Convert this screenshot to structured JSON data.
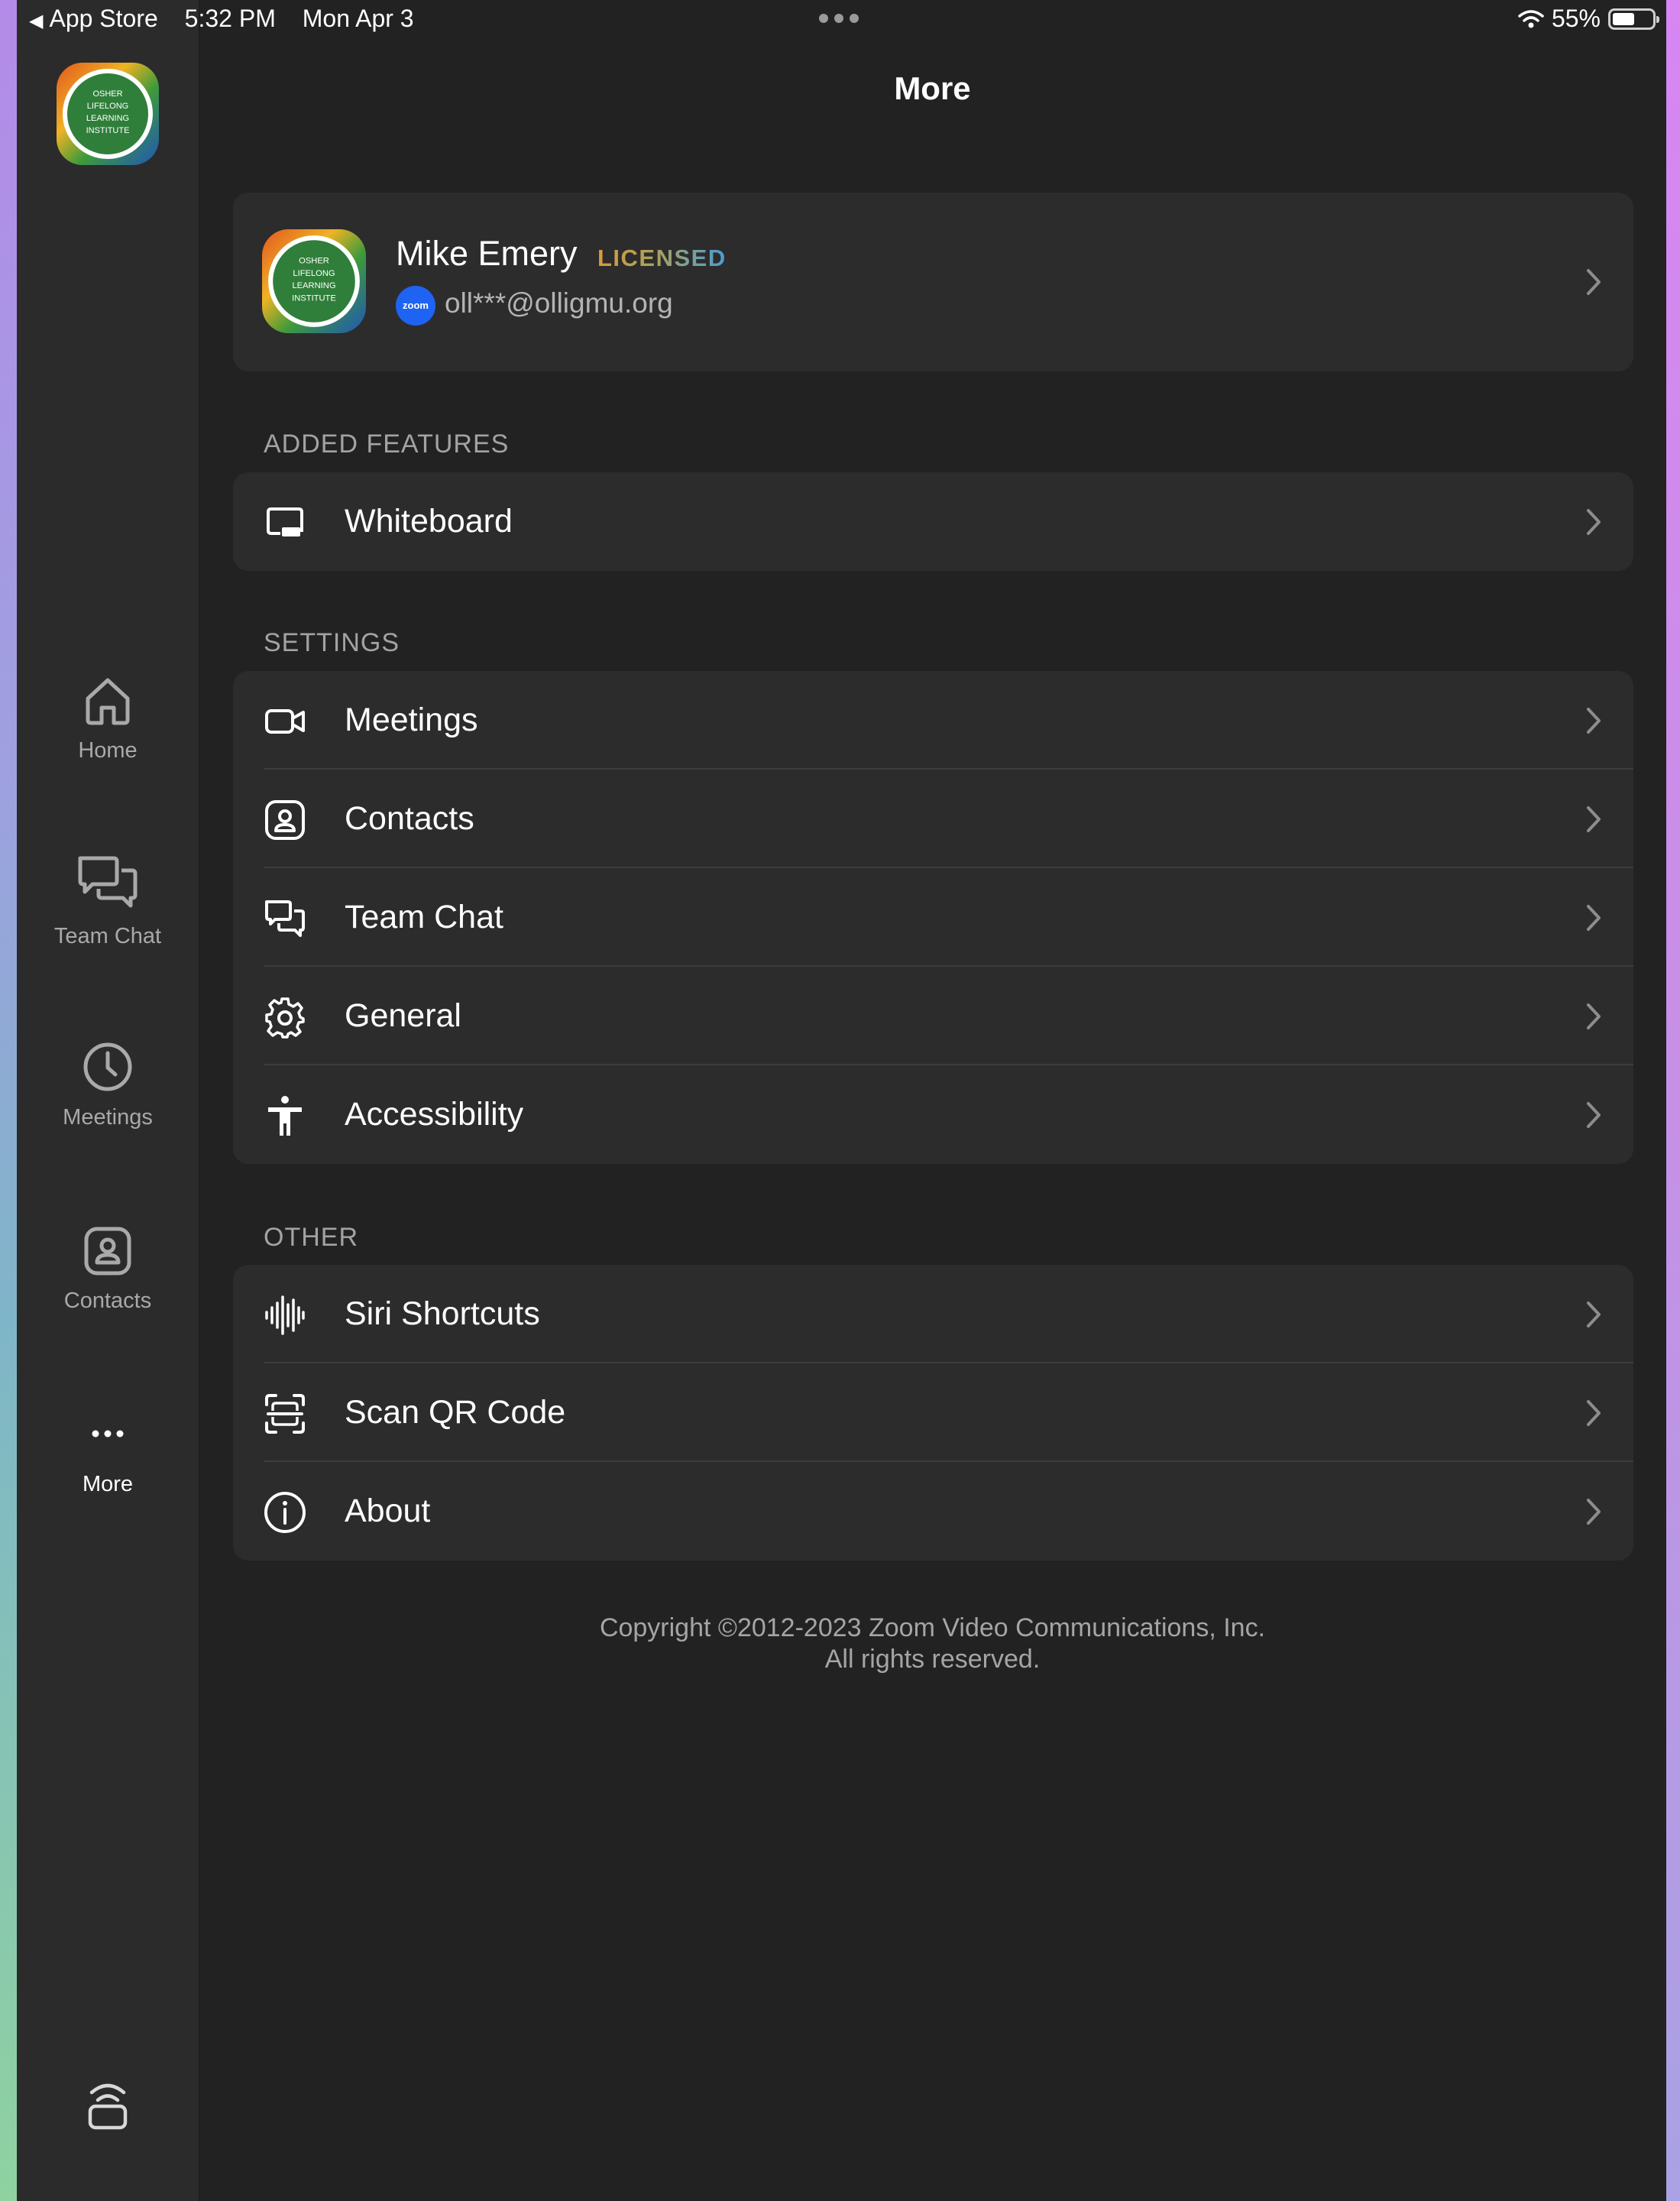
{
  "status_bar": {
    "back_label": "App Store",
    "time": "5:32 PM",
    "date": "Mon Apr 3",
    "battery": "55%",
    "battery_level": 0.55
  },
  "sidebar": {
    "logo_text": "OSHER LIFELONG LEARNING INSTITUTE",
    "items": [
      {
        "label": "Home",
        "icon": "home-icon",
        "active": false
      },
      {
        "label": "Team Chat",
        "icon": "chat-bubbles-icon",
        "active": false
      },
      {
        "label": "Meetings",
        "icon": "clock-icon",
        "active": false
      },
      {
        "label": "Contacts",
        "icon": "contact-card-icon",
        "active": false
      },
      {
        "label": "More",
        "icon": "more-dots-icon",
        "active": true
      }
    ],
    "bottom_icon": "ultrasonic-share-icon"
  },
  "page": {
    "title": "More"
  },
  "profile": {
    "name": "Mike Emery",
    "badge": "LICENSED",
    "email": "oll***@olligmu.org",
    "zoom_chip": "zoom"
  },
  "sections": {
    "added_features": {
      "header": "ADDED FEATURES",
      "items": [
        {
          "label": "Whiteboard",
          "icon": "whiteboard-icon"
        }
      ]
    },
    "settings": {
      "header": "SETTINGS",
      "items": [
        {
          "label": "Meetings",
          "icon": "video-camera-icon"
        },
        {
          "label": "Contacts",
          "icon": "contact-card-icon"
        },
        {
          "label": "Team Chat",
          "icon": "chat-bubbles-icon"
        },
        {
          "label": "General",
          "icon": "gear-icon"
        },
        {
          "label": "Accessibility",
          "icon": "accessibility-icon"
        }
      ]
    },
    "other": {
      "header": "OTHER",
      "items": [
        {
          "label": "Siri Shortcuts",
          "icon": "waveform-icon"
        },
        {
          "label": "Scan QR Code",
          "icon": "qr-scan-icon"
        },
        {
          "label": "About",
          "icon": "info-icon"
        }
      ]
    }
  },
  "footer": {
    "copyright_line1": "Copyright ©2012-2023 Zoom Video Communications, Inc.",
    "copyright_line2": "All rights reserved."
  },
  "colors": {
    "background": "#222222",
    "sidebar": "#2b2b2b",
    "card": "#2c2c2c",
    "secondary_text": "#a3a3a3",
    "zoom_blue": "#1f63f2"
  }
}
